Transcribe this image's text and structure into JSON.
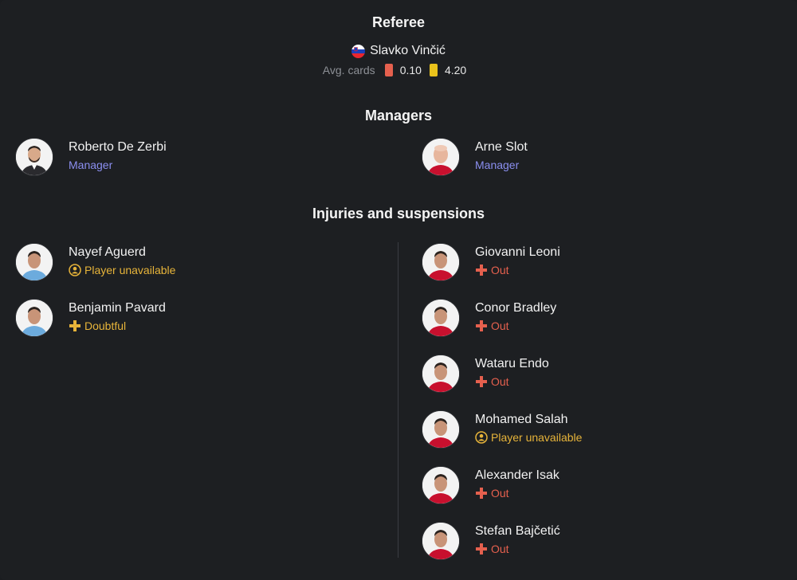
{
  "referee": {
    "title": "Referee",
    "name": "Slavko Vinčić",
    "flag_icon": "slovenia-flag",
    "avg_cards_label": "Avg. cards",
    "red_cards": "0.10",
    "yellow_cards": "4.20",
    "colors": {
      "red": "#e5604e",
      "yellow": "#e9c21b"
    }
  },
  "managers": {
    "title": "Managers",
    "home": {
      "name": "Roberto De Zerbi",
      "role": "Manager"
    },
    "away": {
      "name": "Arne Slot",
      "role": "Manager"
    }
  },
  "injuries": {
    "title": "Injuries and suspensions",
    "home": [
      {
        "name": "Nayef Aguerd",
        "status": "Player unavailable",
        "status_icon": "player-unavailable-icon"
      },
      {
        "name": "Benjamin Pavard",
        "status": "Doubtful",
        "status_icon": "doubtful-cross-icon"
      }
    ],
    "away": [
      {
        "name": "Giovanni Leoni",
        "status": "Out",
        "status_icon": "out-cross-icon"
      },
      {
        "name": "Conor Bradley",
        "status": "Out",
        "status_icon": "out-cross-icon"
      },
      {
        "name": "Wataru Endo",
        "status": "Out",
        "status_icon": "out-cross-icon"
      },
      {
        "name": "Mohamed Salah",
        "status": "Player unavailable",
        "status_icon": "player-unavailable-icon"
      },
      {
        "name": "Alexander Isak",
        "status": "Out",
        "status_icon": "out-cross-icon"
      },
      {
        "name": "Stefan Bajčetić",
        "status": "Out",
        "status_icon": "out-cross-icon"
      }
    ]
  },
  "colors": {
    "background": "#1d1f22",
    "manager_role": "#8b8ff0",
    "out": "#e5604e",
    "doubtful": "#e7b43a",
    "unavailable": "#e7b43a"
  }
}
